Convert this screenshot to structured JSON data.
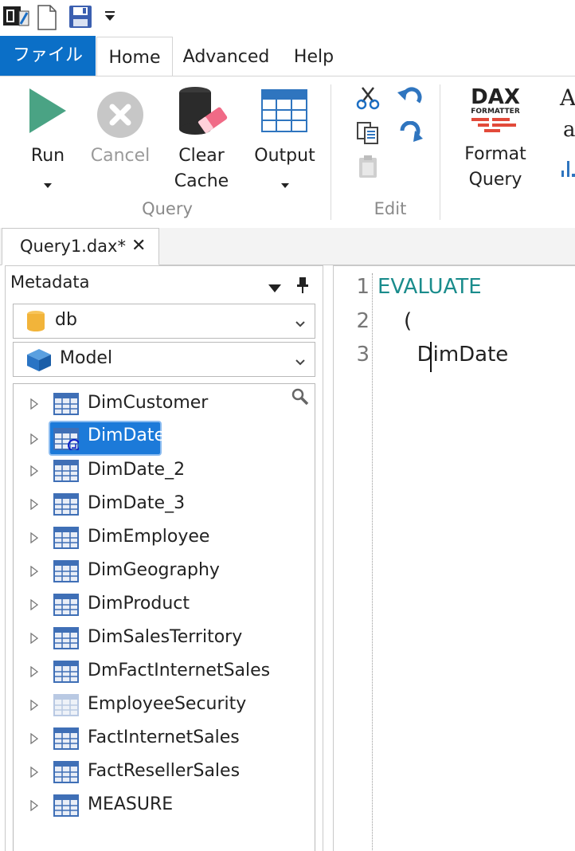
{
  "qat": {
    "icons": [
      "dax-studio-logo-icon",
      "new-document-icon",
      "save-icon",
      "customize-dropdown-icon"
    ]
  },
  "ribbon_tabs": {
    "file": "ファイル",
    "home": "Home",
    "advanced": "Advanced",
    "help": "Help"
  },
  "ribbon": {
    "run": "Run",
    "cancel": "Cancel",
    "clear_cache_1": "Clear",
    "clear_cache_2": "Cache",
    "output": "Output",
    "format_query_1": "Format",
    "format_query_2": "Query",
    "dax_logo_top": "DAX",
    "dax_logo_bottom": "FORMATTER",
    "partial_text_1": "A",
    "partial_text_2": "a",
    "group_query": "Query",
    "group_edit": "Edit"
  },
  "document": {
    "tab_title": "Query1.dax*",
    "close_glyph": "✕"
  },
  "metadata": {
    "title": "Metadata",
    "database": "db",
    "model": "Model",
    "tables": [
      {
        "name": "DimCustomer",
        "selected": false,
        "hidden": false
      },
      {
        "name": "DimDate",
        "selected": true,
        "hidden": false
      },
      {
        "name": "DimDate_2",
        "selected": false,
        "hidden": false
      },
      {
        "name": "DimDate_3",
        "selected": false,
        "hidden": false
      },
      {
        "name": "DimEmployee",
        "selected": false,
        "hidden": false
      },
      {
        "name": "DimGeography",
        "selected": false,
        "hidden": false
      },
      {
        "name": "DimProduct",
        "selected": false,
        "hidden": false
      },
      {
        "name": "DimSalesTerritory",
        "selected": false,
        "hidden": false
      },
      {
        "name": "DmFactInternetSales",
        "selected": false,
        "hidden": false
      },
      {
        "name": "EmployeeSecurity",
        "selected": false,
        "hidden": true
      },
      {
        "name": "FactInternetSales",
        "selected": false,
        "hidden": false
      },
      {
        "name": "FactResellerSales",
        "selected": false,
        "hidden": false
      },
      {
        "name": "MEASURE",
        "selected": false,
        "hidden": false
      }
    ]
  },
  "editor": {
    "lines": [
      {
        "number": "1",
        "text": "EVALUATE"
      },
      {
        "number": "2",
        "text": "    ("
      },
      {
        "number": "3",
        "text": "      DimDate"
      }
    ]
  },
  "colors": {
    "file_tab": "#0b6fc7",
    "selection": "#1c7ad9",
    "keyword": "#1a8c8c"
  }
}
